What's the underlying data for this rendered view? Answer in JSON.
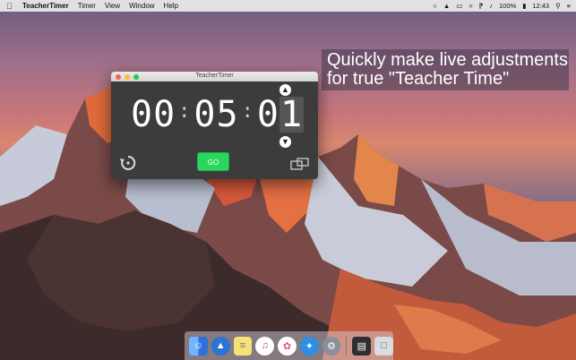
{
  "menubar": {
    "app_name": "TeacherTimer",
    "menus": [
      "Timer",
      "View",
      "Window",
      "Help"
    ],
    "battery": "100%",
    "time": "12:43"
  },
  "caption": {
    "line1": "Quickly make live adjustments",
    "line2": "for true \"Teacher Time\""
  },
  "window": {
    "title": "TeacherTimer",
    "hours": "00",
    "minutes": "05",
    "seconds_tens": "0",
    "seconds_ones": "1",
    "go_label": "GO"
  },
  "dock": {
    "items": [
      "finder-icon",
      "launchpad-icon",
      "notes-icon",
      "itunes-icon",
      "photos-icon",
      "safari-icon",
      "system-preferences-icon",
      "presentation-icon",
      "trash-icon"
    ]
  }
}
